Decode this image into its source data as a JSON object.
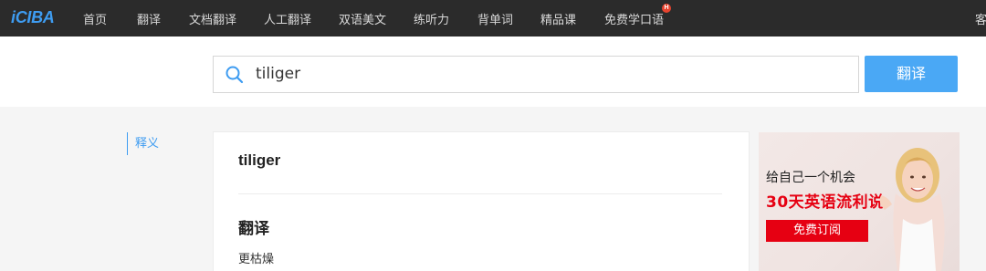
{
  "header": {
    "logo": "iCIBA",
    "nav": [
      "首页",
      "翻译",
      "文档翻译",
      "人工翻译",
      "双语美文",
      "练听力",
      "背单词",
      "精品课",
      "免费学口语"
    ],
    "hot_badge": "H",
    "overflow": "客"
  },
  "search": {
    "value": "tiliger",
    "button": "翻译"
  },
  "sidebar": {
    "tab": "释义"
  },
  "result": {
    "word": "tiliger",
    "section_title": "翻译",
    "meaning": "更枯燥"
  },
  "ad": {
    "line1": "给自己一个机会",
    "line2": "30天英语流利说",
    "button": "免费订阅"
  },
  "colors": {
    "accent": "#3e9cf1",
    "topbar": "#2b2b2b",
    "ad_red": "#e60012"
  }
}
